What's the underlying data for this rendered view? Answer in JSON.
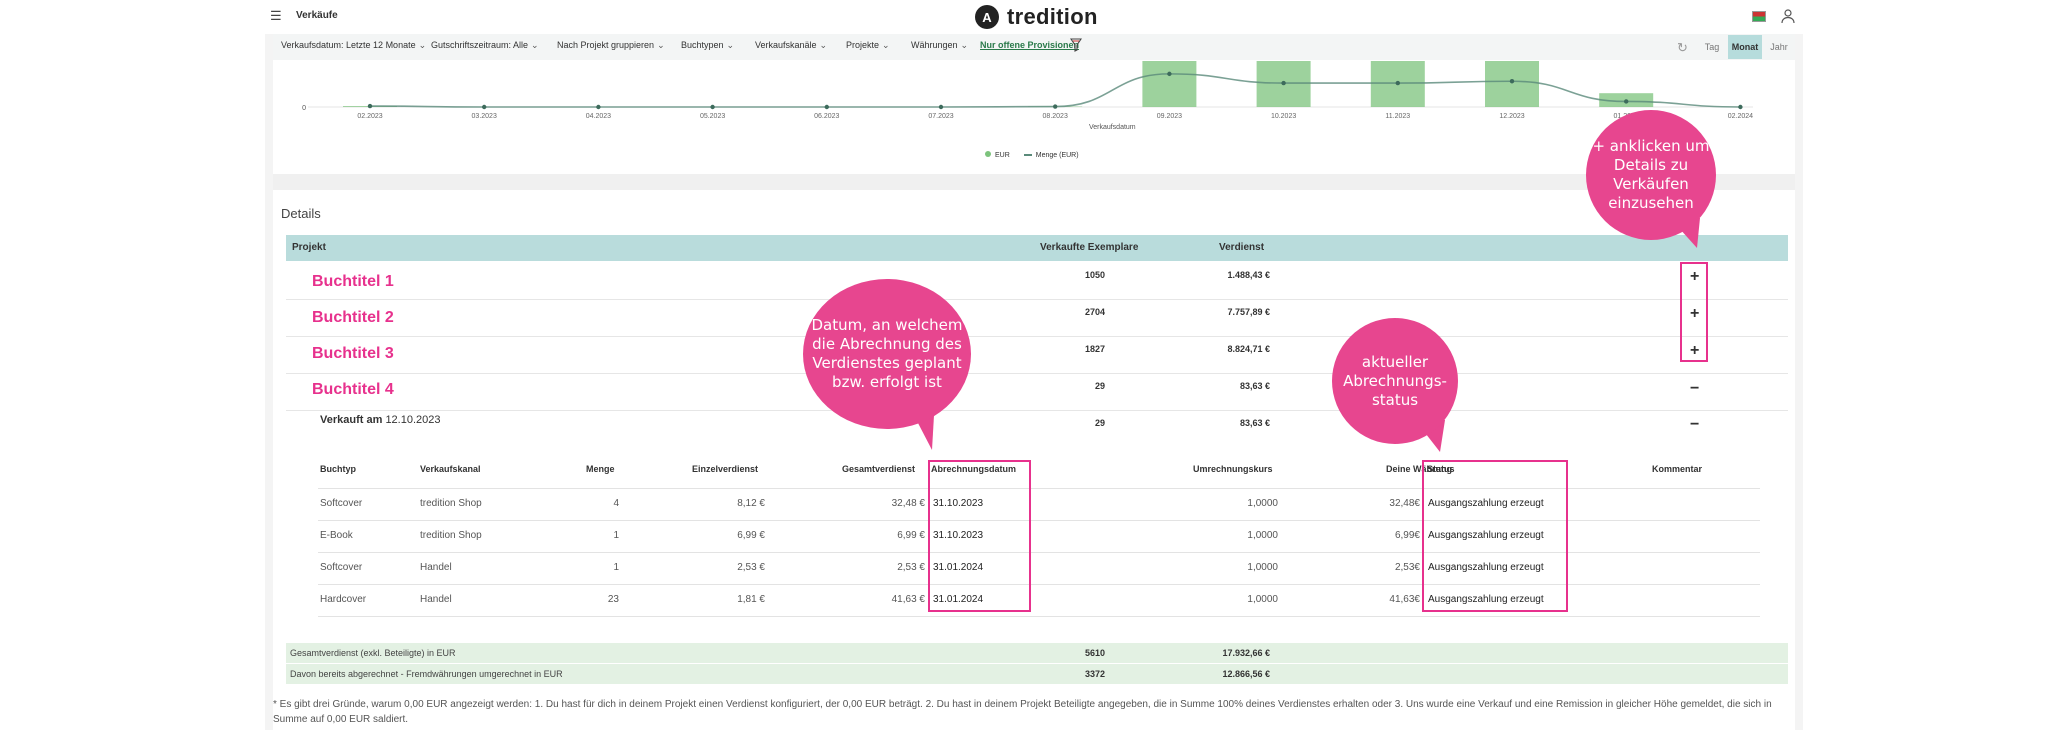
{
  "header": {
    "menu_icon": "hamburger-icon",
    "section": "Verkäufe",
    "logo_mark": "A",
    "brand": "tredition",
    "flag_icon": "flag-icon",
    "user_icon": "user-icon"
  },
  "filters": [
    {
      "label": "Verkaufsdatum: Letzte 12 Monate"
    },
    {
      "label": "Gutschriftszeitraum: Alle"
    },
    {
      "label": "Nach Projekt gruppieren"
    },
    {
      "label": "Buchtypen"
    },
    {
      "label": "Verkaufskanäle"
    },
    {
      "label": "Projekte"
    },
    {
      "label": "Währungen"
    },
    {
      "label": "Nur offene Provisionen"
    }
  ],
  "range": {
    "day": "Tag",
    "month": "Monat",
    "year": "Jahr",
    "selected": "Monat"
  },
  "chart_data": {
    "type": "bar",
    "categories": [
      "02.2023",
      "03.2023",
      "04.2023",
      "05.2023",
      "06.2023",
      "07.2023",
      "08.2023",
      "09.2023",
      "10.2023",
      "11.2023",
      "12.2023",
      "01.2024",
      "02.2024"
    ],
    "series": [
      {
        "name": "EUR",
        "color": "#7cc37c",
        "values": [
          2,
          0,
          0,
          0,
          0,
          0,
          1,
          100,
          100,
          100,
          100,
          30,
          0
        ]
      },
      {
        "name": "Menge (EUR)",
        "type": "line",
        "color": "#5a8a7a",
        "values": [
          2,
          0,
          0,
          0,
          0,
          0,
          1,
          72,
          52,
          52,
          56,
          12,
          0
        ]
      }
    ],
    "y_tick": "0",
    "xlabel": "Verkaufsdatum",
    "ylim": [
      0,
      100
    ],
    "legend_position": "bottom"
  },
  "details": {
    "title": "Details",
    "columns": {
      "project": "Projekt",
      "sold": "Verkaufte Exemplare",
      "earnings": "Verdienst"
    },
    "rows": [
      {
        "title": "Buchtitel 1",
        "sold": "1050",
        "earnings": "1.488,43 €",
        "toggle": "+"
      },
      {
        "title": "Buchtitel 2",
        "sold": "2704",
        "earnings": "7.757,89 €",
        "toggle": "+"
      },
      {
        "title": "Buchtitel 3",
        "sold": "1827",
        "earnings": "8.824,71 €",
        "toggle": "+"
      },
      {
        "title": "Buchtitel 4",
        "sold": "29",
        "earnings": "83,63 €",
        "toggle": "−"
      }
    ],
    "sold_on": {
      "label": "Verkauft am",
      "date": "12.10.2023",
      "sold": "29",
      "earnings": "83,63 €",
      "toggle": "−"
    },
    "sub_columns": {
      "type": "Buchtyp",
      "channel": "Verkaufskanal",
      "qty": "Menge",
      "unit": "Einzelverdienst",
      "total": "Gesamtverdienst",
      "settle_date": "Abrechnungsdatum",
      "rate": "Umrechnungskurs",
      "currency": "Deine Währung",
      "status": "Status",
      "comment": "Kommentar"
    },
    "sub_rows": [
      {
        "type": "Softcover",
        "channel": "tredition Shop",
        "qty": "4",
        "unit": "8,12 €",
        "total": "32,48 €",
        "settle_date": "31.10.2023",
        "rate": "1,0000",
        "currency": "32,48€",
        "status": "Ausgangszahlung erzeugt"
      },
      {
        "type": "E-Book",
        "channel": "tredition Shop",
        "qty": "1",
        "unit": "6,99 €",
        "total": "6,99 €",
        "settle_date": "31.10.2023",
        "rate": "1,0000",
        "currency": "6,99€",
        "status": "Ausgangszahlung erzeugt"
      },
      {
        "type": "Softcover",
        "channel": "Handel",
        "qty": "1",
        "unit": "2,53 €",
        "total": "2,53 €",
        "settle_date": "31.01.2024",
        "rate": "1,0000",
        "currency": "2,53€",
        "status": "Ausgangszahlung erzeugt"
      },
      {
        "type": "Hardcover",
        "channel": "Handel",
        "qty": "23",
        "unit": "1,81 €",
        "total": "41,63 €",
        "settle_date": "31.01.2024",
        "rate": "1,0000",
        "currency": "41,63€",
        "status": "Ausgangszahlung erzeugt"
      }
    ],
    "totals": [
      {
        "label": "Gesamtverdienst (exkl. Beteiligte) in EUR",
        "sold": "5610",
        "earnings": "17.932,66 €"
      },
      {
        "label": "Davon bereits abgerechnet - Fremdwährungen umgerechnet in EUR",
        "sold": "3372",
        "earnings": "12.866,56 €"
      }
    ],
    "footnote": "* Es gibt drei Gründe, warum 0,00 EUR angezeigt werden: 1. Du hast für dich in deinem Projekt einen Verdienst konfiguriert, der 0,00 EUR beträgt. 2. Du hast in deinem Projekt Beteiligte angegeben, die in Summe 100% deines Verdienstes erhalten oder 3. Uns wurde eine Verkauf und eine Remission in gleicher Höhe gemeldet, die sich in Summe auf 0,00 EUR saldiert."
  },
  "callouts": {
    "date": "Datum, an welchem die Abrechnung des Verdienstes geplant bzw. erfolgt ist",
    "status": "aktueller Abrechnungs- status",
    "plus": "+ anklicken um Details zu Verkäufen einzusehen"
  }
}
